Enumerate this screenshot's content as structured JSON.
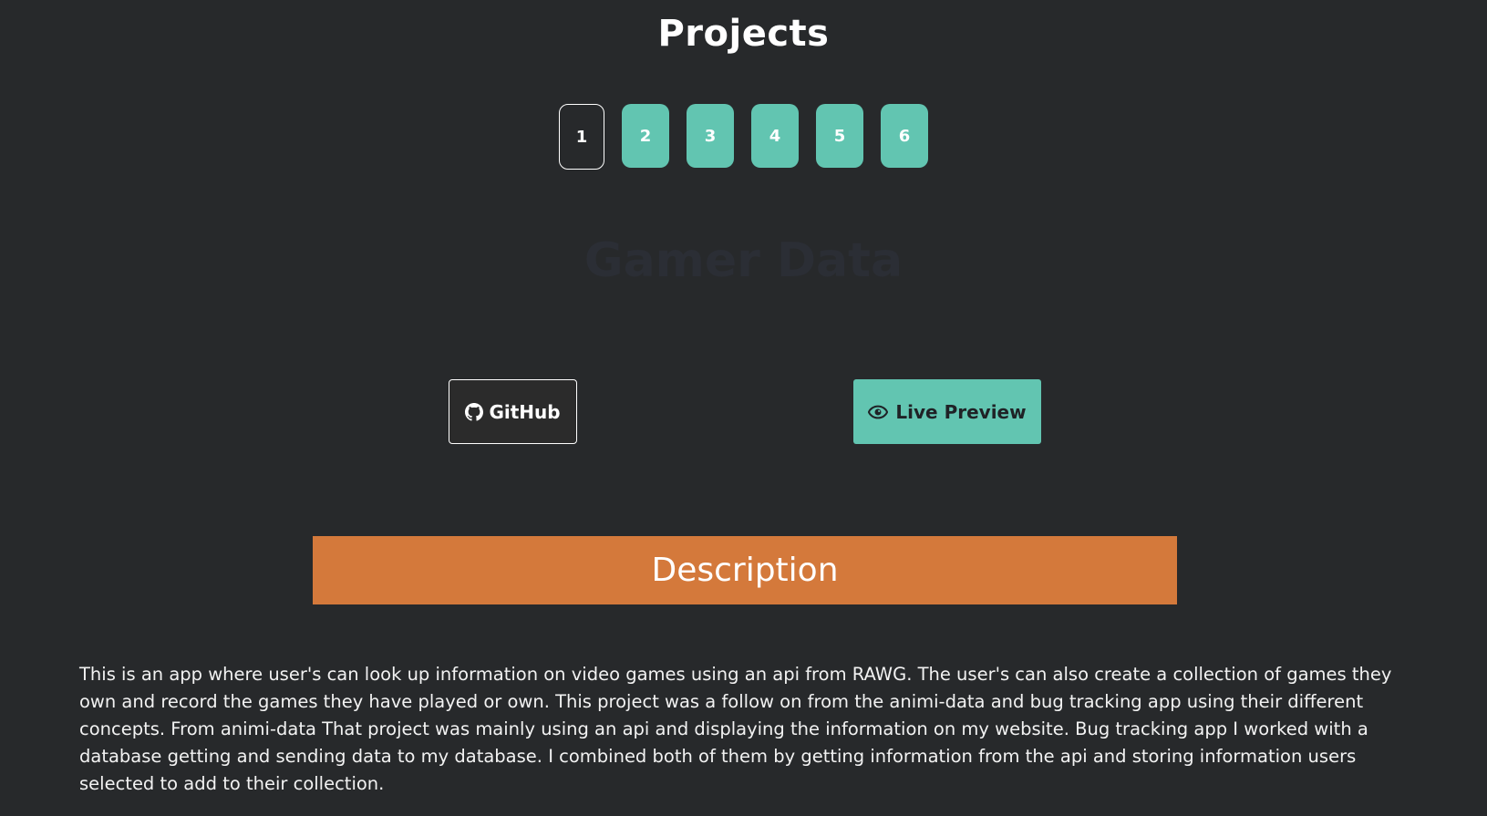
{
  "header": {
    "title": "Projects"
  },
  "pagination": {
    "pages": [
      "1",
      "2",
      "3",
      "4",
      "5",
      "6"
    ],
    "active": "1"
  },
  "project": {
    "title": "Gamer Data",
    "github_label": "GitHub",
    "github_icon": "github-icon",
    "live_label": "Live Preview",
    "live_icon": "eye-icon"
  },
  "description": {
    "heading": "Description",
    "text": "This is an app where user's can look up information on video games using an api from RAWG. The user's can also create a collection of games they own and record the games they have played or own. This project was a follow on from the animi-data and bug tracking app using their different concepts. From animi-data That project was mainly using an api and displaying the information on my website. Bug tracking app I worked with a database getting and sending data to my database. I combined both of them by getting information from the api and storing information users selected to add to their collection."
  },
  "colors": {
    "background": "#27292b",
    "accent_teal": "#62c5b1",
    "accent_orange": "#d4793b",
    "project_title": "#2b2e35"
  }
}
